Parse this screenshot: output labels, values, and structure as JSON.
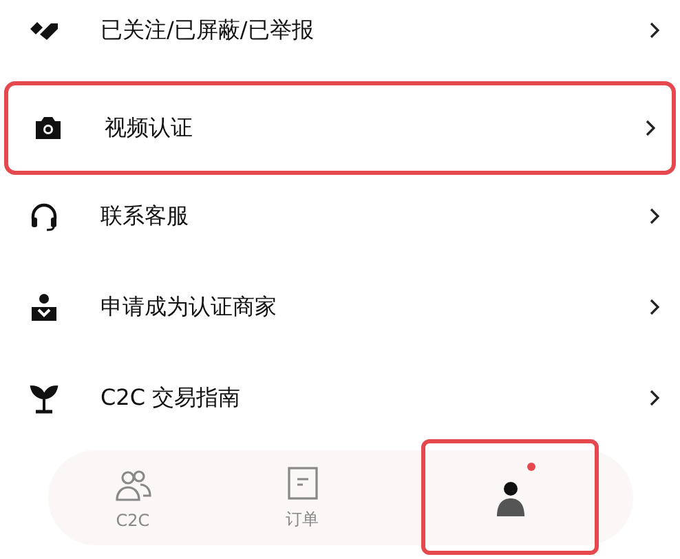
{
  "menu": [
    {
      "kind": "tag",
      "label": "已关注/已屏蔽/已举报",
      "highlighted": false
    },
    {
      "kind": "camera",
      "label": "视频认证",
      "highlighted": true
    },
    {
      "kind": "headset",
      "label": "联系客服",
      "highlighted": false
    },
    {
      "kind": "merchant",
      "label": "申请成为认证商家",
      "highlighted": false
    },
    {
      "kind": "sprout",
      "label": "C2C 交易指南",
      "highlighted": false
    }
  ],
  "tabs": [
    {
      "kind": "people",
      "label": "C2C",
      "selected": false,
      "badge": false,
      "highlighted": false
    },
    {
      "kind": "order",
      "label": "订单",
      "selected": false,
      "badge": false,
      "highlighted": false
    },
    {
      "kind": "person",
      "selected": true,
      "badge": true,
      "highlighted": true
    }
  ]
}
